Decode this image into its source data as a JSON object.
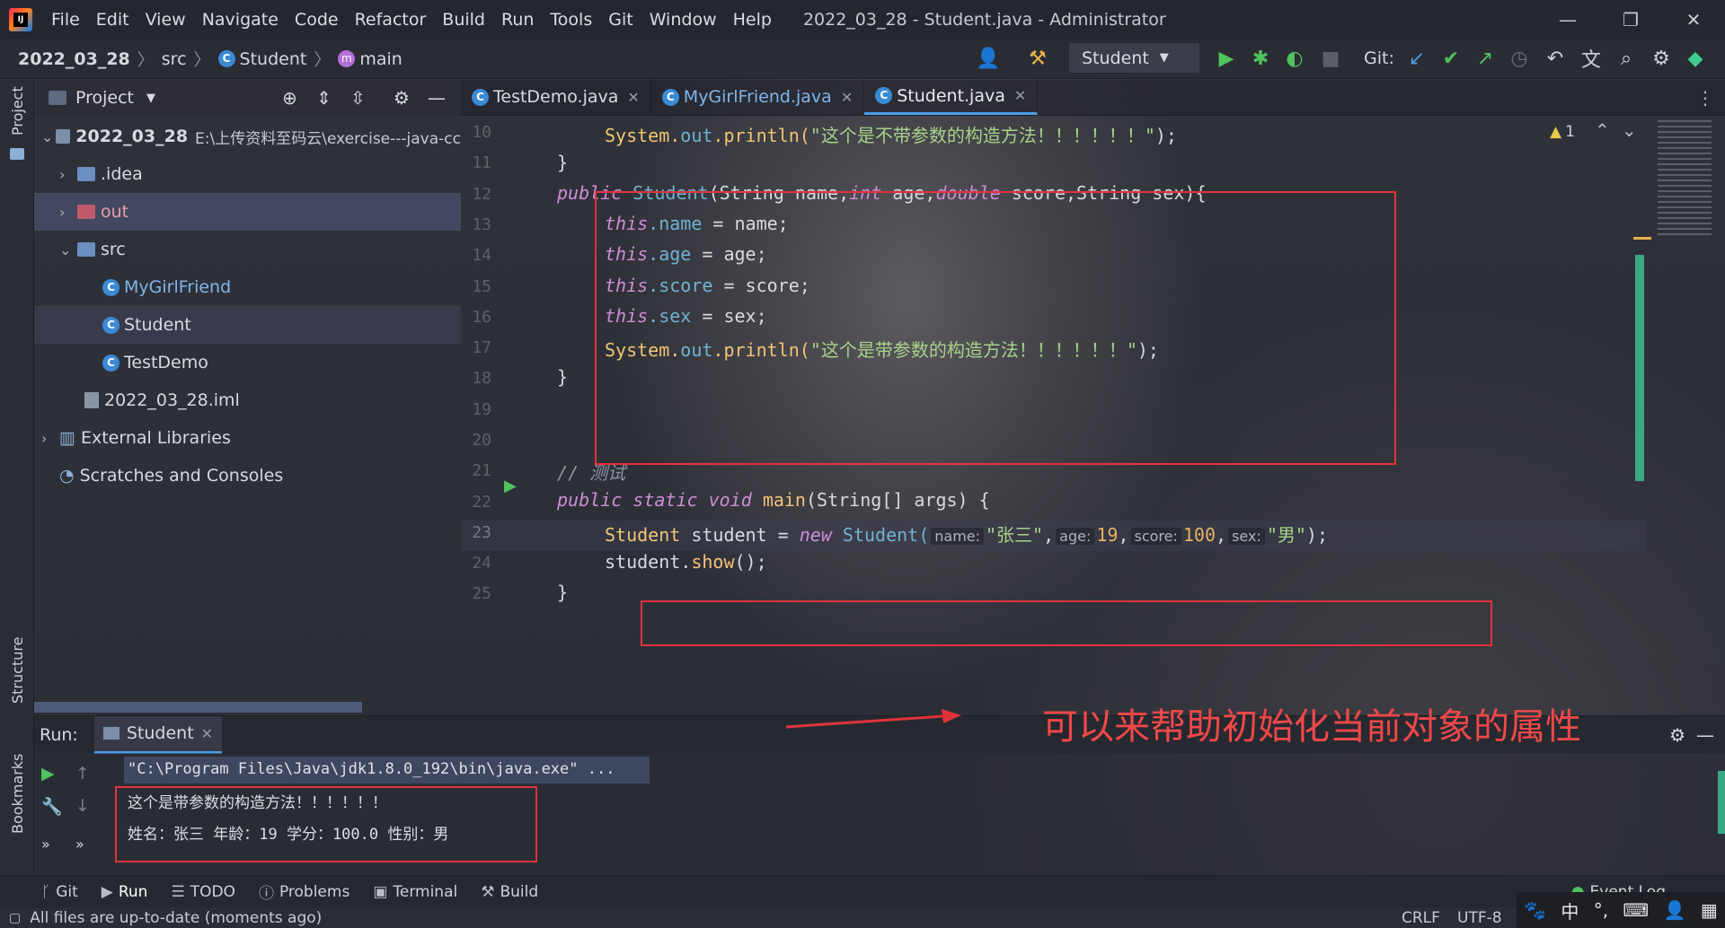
{
  "app": {
    "menu": [
      "File",
      "Edit",
      "View",
      "Navigate",
      "Code",
      "Refactor",
      "Build",
      "Run",
      "Tools",
      "Git",
      "Window",
      "Help"
    ],
    "window_title": "2022_03_28 - Student.java - Administrator"
  },
  "breadcrumb": {
    "project": "2022_03_28",
    "folder": "src",
    "class": "Student",
    "method": "main"
  },
  "toolbar": {
    "run_config": "Student",
    "git_label": "Git:"
  },
  "project_panel": {
    "title": "Project",
    "root_name": "2022_03_28",
    "root_path": "E:\\上传资料至码云\\exercise---java-cc",
    "items": [
      ".idea",
      "out",
      "src",
      "MyGirlFriend",
      "Student",
      "TestDemo",
      "2022_03_28.iml",
      "External Libraries",
      "Scratches and Consoles"
    ]
  },
  "editor": {
    "tabs": [
      "TestDemo.java",
      "MyGirlFriend.java",
      "Student.java"
    ],
    "warning_count": "1",
    "line_numbers": [
      "10",
      "11",
      "12",
      "13",
      "14",
      "15",
      "16",
      "17",
      "18",
      "19",
      "20",
      "21",
      "22",
      "23",
      "24",
      "25"
    ],
    "lines": {
      "l10_pre": "System.",
      "l10_out": "out",
      "l10_println": ".println(",
      "l10_str": "\"这个是不带参数的构造方法！！！！！！\"",
      "l10_end": ");",
      "l11": "}",
      "l12_public": "public",
      "l12_name": "Student",
      "l12_params": "(String name,",
      "l12_int": "int",
      "l12_age": " age,",
      "l12_double": "double",
      "l12_rest": " score,String sex){",
      "this": "this",
      "f_name": ".name",
      "f_age": ".age",
      "f_score": ".score",
      "f_sex": ".sex",
      "a_name": " = name;",
      "a_age": " = age;",
      "a_score": " = score;",
      "a_sex": " = sex;",
      "l17_str": "\"这个是带参数的构造方法！！！！！！\"",
      "l18": "}",
      "l21": "// 测试",
      "l22_public": "public",
      "l22_static": "static",
      "l22_void": "void",
      "l22_main": "main",
      "l22_rest": "(String[] args) {",
      "l23_type": "Student",
      "l23_var": " student = ",
      "l23_new": "new",
      "l23_ctor": " Student(",
      "hint_name": "name:",
      "arg_name": "\"张三\"",
      "hint_age": "age:",
      "arg_age": "19",
      "hint_score": "score:",
      "arg_score": "100",
      "hint_sex": "sex:",
      "arg_sex": "\"男\"",
      "l23_end": ");",
      "l24_obj": "student.",
      "l24_call": "show",
      "l24_end": "();",
      "l25": "}"
    }
  },
  "annotation": "可以来帮助初始化当前对象的属性",
  "run_panel": {
    "label": "Run:",
    "tab": "Student",
    "command": "\"C:\\Program Files\\Java\\jdk1.8.0_192\\bin\\java.exe\" ...",
    "output": [
      "这个是带参数的构造方法！！！！！！",
      "姓名：张三 年龄：19 学分：100.0 性别：男"
    ]
  },
  "bottom_tabs": [
    "Git",
    "Run",
    "TODO",
    "Problems",
    "Terminal",
    "Build"
  ],
  "event_log": "Event Log",
  "status": {
    "message": "All files are up-to-date (moments ago)",
    "line_sep": "CRLF",
    "encoding": "UTF-8"
  },
  "colors": {
    "accent": "#4a9fe8",
    "highlight_box": "#e0333a",
    "selection": "#4b4f6e"
  }
}
